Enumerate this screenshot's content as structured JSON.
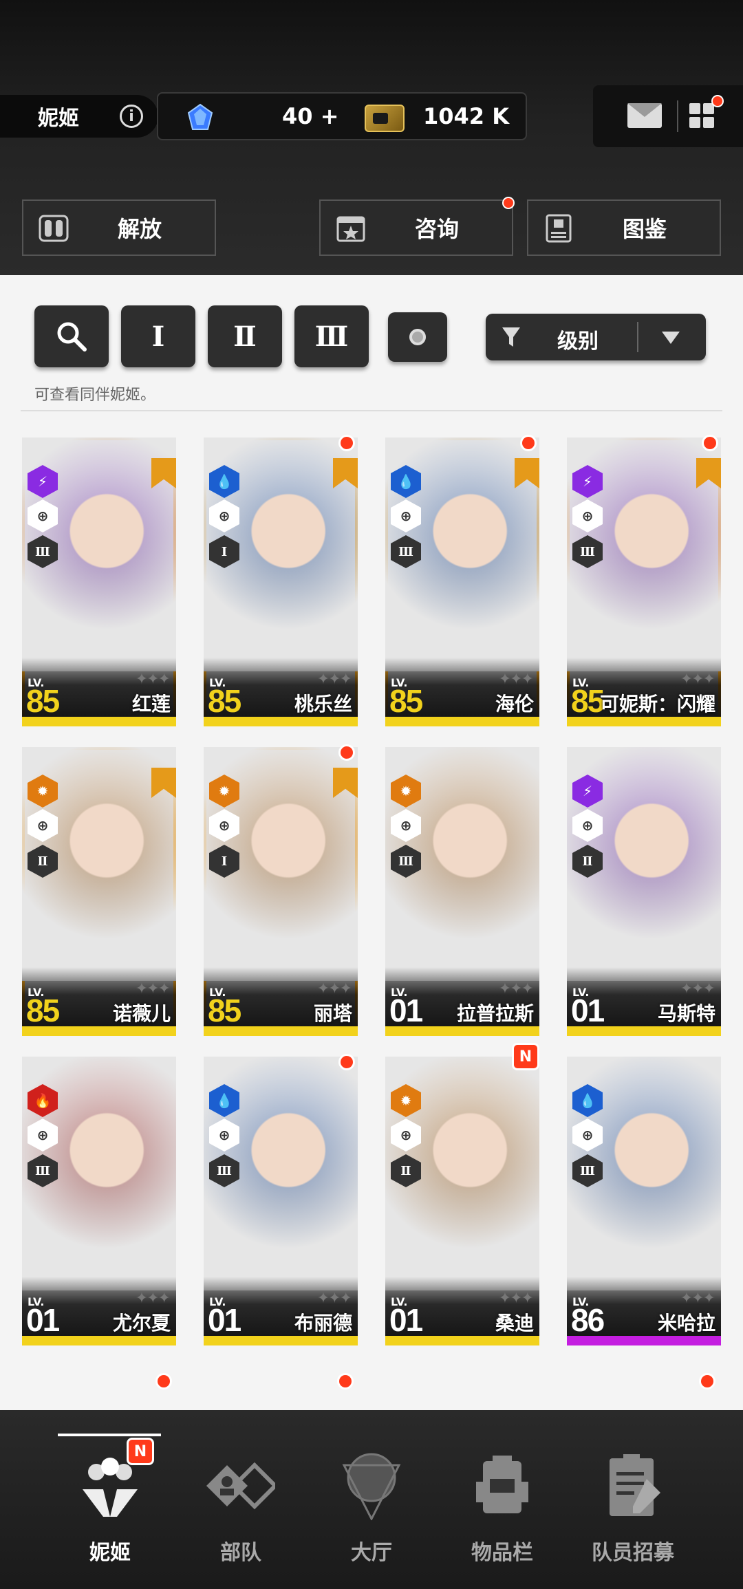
{
  "header": {
    "title": "妮姬",
    "info_icon": "i",
    "gems": "40",
    "gems_add": "+",
    "credits": "1042 K"
  },
  "buttons": {
    "release": "解放",
    "consult": "咨询",
    "codex": "图鉴"
  },
  "filters": {
    "search_icon": "search-icon",
    "burst1": "Ⅰ",
    "burst2": "Ⅱ",
    "burst3": "Ⅲ",
    "sort_label": "级别",
    "hint": "可查看同伴妮姬。"
  },
  "nikkes": [
    {
      "name": "红莲",
      "lv_label": "LV.",
      "level": "85",
      "element": "electric",
      "element_color": "#8a2be2",
      "burst": "Ⅲ",
      "rarity_bar": "#f2d21c",
      "level_color": "#f2d21c",
      "sc": true,
      "dot": false
    },
    {
      "name": "桃乐丝",
      "lv_label": "LV.",
      "level": "85",
      "element": "water",
      "element_color": "#1c5fd0",
      "burst": "Ⅰ",
      "rarity_bar": "#f2d21c",
      "level_color": "#f2d21c",
      "sc": true,
      "dot": true
    },
    {
      "name": "海伦",
      "lv_label": "LV.",
      "level": "85",
      "element": "water",
      "element_color": "#1c5fd0",
      "burst": "Ⅲ",
      "rarity_bar": "#f2d21c",
      "level_color": "#f2d21c",
      "sc": true,
      "dot": true
    },
    {
      "name": "可妮斯：闪耀",
      "lv_label": "LV.",
      "level": "85",
      "element": "electric",
      "element_color": "#8a2be2",
      "burst": "Ⅲ",
      "rarity_bar": "#f2d21c",
      "level_color": "#f2d21c",
      "sc": true,
      "dot": true
    },
    {
      "name": "诺薇儿",
      "lv_label": "LV.",
      "level": "85",
      "element": "iron",
      "element_color": "#e07b10",
      "burst": "Ⅱ",
      "rarity_bar": "#f2d21c",
      "level_color": "#f2d21c",
      "sc": true,
      "dot": false
    },
    {
      "name": "丽塔",
      "lv_label": "LV.",
      "level": "85",
      "element": "iron",
      "element_color": "#e07b10",
      "burst": "Ⅰ",
      "rarity_bar": "#f2d21c",
      "level_color": "#f2d21c",
      "sc": true,
      "dot": true
    },
    {
      "name": "拉普拉斯",
      "lv_label": "LV.",
      "level": "01",
      "element": "iron",
      "element_color": "#e07b10",
      "burst": "Ⅲ",
      "rarity_bar": "#f2d21c",
      "level_color": "#ffffff",
      "sc": false,
      "dot": false
    },
    {
      "name": "马斯特",
      "lv_label": "LV.",
      "level": "01",
      "element": "electric",
      "element_color": "#8a2be2",
      "burst": "Ⅱ",
      "rarity_bar": "#f2d21c",
      "level_color": "#ffffff",
      "sc": false,
      "dot": false
    },
    {
      "name": "尤尔夏",
      "lv_label": "LV.",
      "level": "01",
      "element": "fire",
      "element_color": "#d0201c",
      "burst": "Ⅲ",
      "rarity_bar": "#f2d21c",
      "level_color": "#ffffff",
      "sc": false,
      "dot": false
    },
    {
      "name": "布丽德",
      "lv_label": "LV.",
      "level": "01",
      "element": "water",
      "element_color": "#1c5fd0",
      "burst": "Ⅲ",
      "rarity_bar": "#f2d21c",
      "level_color": "#ffffff",
      "sc": false,
      "dot": true
    },
    {
      "name": "桑迪",
      "lv_label": "LV.",
      "level": "01",
      "element": "iron",
      "element_color": "#e07b10",
      "burst": "Ⅱ",
      "rarity_bar": "#f2d21c",
      "level_color": "#ffffff",
      "sc": false,
      "dot": false,
      "badge": "N"
    },
    {
      "name": "米哈拉",
      "lv_label": "LV.",
      "level": "86",
      "element": "water",
      "element_color": "#1c5fd0",
      "burst": "Ⅲ",
      "rarity_bar": "#c41ee0",
      "level_color": "#ffffff",
      "sc": false,
      "dot": false
    }
  ],
  "nav": {
    "nikke": "妮姬",
    "squad": "部队",
    "lobby": "大厅",
    "inventory": "物品栏",
    "recruit": "队员招募",
    "nikke_badge": "N"
  }
}
